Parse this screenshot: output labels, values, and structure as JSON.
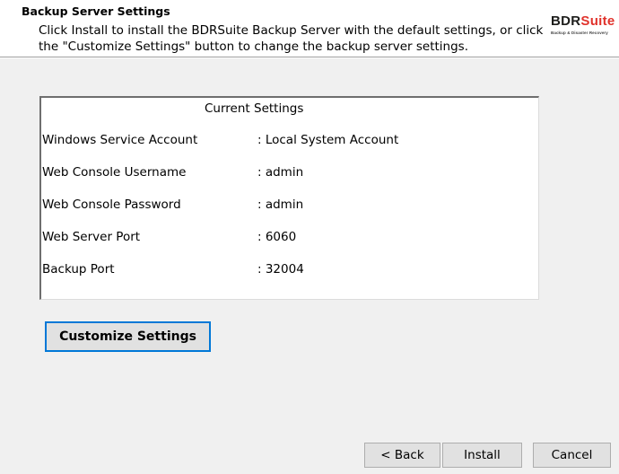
{
  "header": {
    "title": "Backup Server Settings",
    "description": "Click Install to install the BDRSuite Backup Server with the default settings, or click the \"Customize Settings\" button to change the backup server settings.",
    "logo": {
      "brand_part1": "BDR",
      "brand_part2": "Suite",
      "tagline": "Backup & Disaster Recovery",
      "colors": {
        "dark": "#1d1d1b",
        "accent": "#e0322b"
      }
    }
  },
  "settings": {
    "title": "Current Settings",
    "rows": [
      {
        "label": "Windows Service Account",
        "value": ": Local System Account"
      },
      {
        "label": "Web Console Username",
        "value": ": admin"
      },
      {
        "label": "Web Console Password",
        "value": ": admin"
      },
      {
        "label": "Web Server Port",
        "value": ": 6060"
      },
      {
        "label": "Backup Port",
        "value": ": 32004"
      }
    ]
  },
  "buttons": {
    "customize": "Customize Settings",
    "back": "< Back",
    "install": "Install",
    "cancel": "Cancel"
  },
  "colors": {
    "focus_border": "#0078d7",
    "button_face": "#e1e1e1",
    "dialog_background": "#f0f0f0"
  }
}
